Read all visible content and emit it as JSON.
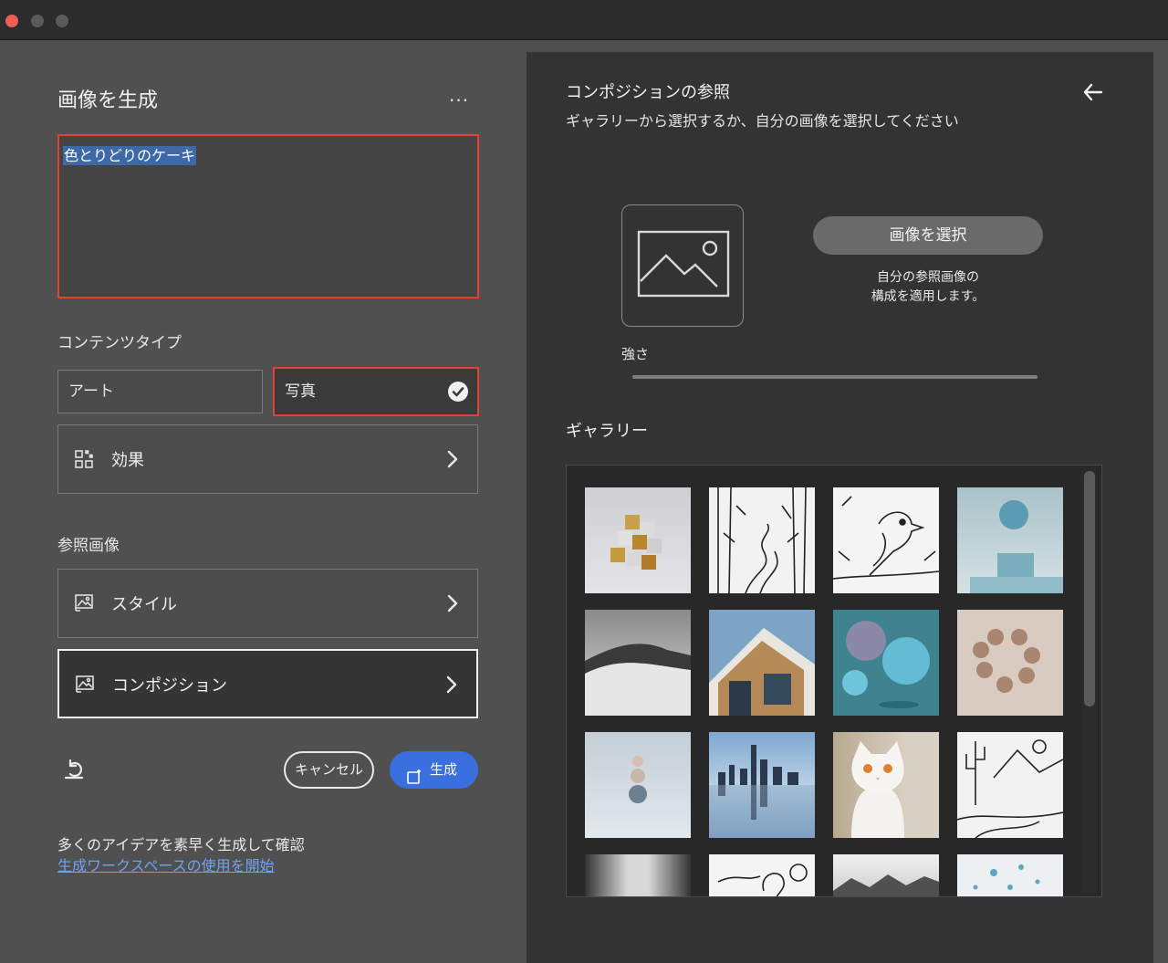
{
  "window": {
    "controls": [
      "close",
      "minimize",
      "zoom"
    ]
  },
  "left": {
    "title": "画像を生成",
    "more_label": "...",
    "prompt": {
      "value": "色とりどりのケーキ"
    },
    "content_type": {
      "label": "コンテンツタイプ",
      "options": [
        {
          "label": "アート",
          "selected": false
        },
        {
          "label": "写真",
          "selected": true
        }
      ]
    },
    "effects": {
      "label": "効果",
      "icon": "effects-grid-icon"
    },
    "reference": {
      "label": "参照画像",
      "style": {
        "label": "スタイル",
        "icon": "image-reference-icon"
      },
      "composition": {
        "label": "コンポジション",
        "icon": "image-reference-icon"
      }
    },
    "actions": {
      "reset_icon": "undo-icon",
      "cancel": "キャンセル",
      "generate": "生成",
      "generate_icon": "generate-sparkle-icon"
    },
    "footer": {
      "tip": "多くのアイデアを素早く生成して確認",
      "link": "生成ワークスペースの使用を開始"
    }
  },
  "right": {
    "title": "コンポジションの参照",
    "subtitle": "ギャラリーから選択するか、自分の画像を選択してください",
    "back_icon": "arrow-left-icon",
    "placeholder_icon": "image-placeholder-icon",
    "select_button": "画像を選択",
    "help_line1": "自分の参照画像の",
    "help_line2": "構成を適用します。",
    "strength_label": "強さ",
    "gallery_label": "ギャラリー",
    "gallery_items": [
      "gold-silver-cubes",
      "forest-line-drawing",
      "bird-line-drawing",
      "blue-sphere-on-pedestal",
      "desert-dunes",
      "modern-building",
      "blue-spheres",
      "floating-beige-spheres",
      "stacked-spheres",
      "city-skyline-reflection",
      "white-cat",
      "cactus-landscape-drawing",
      "corridor",
      "swan-line-drawing",
      "misty-mountains",
      "scattered-dots"
    ]
  }
}
